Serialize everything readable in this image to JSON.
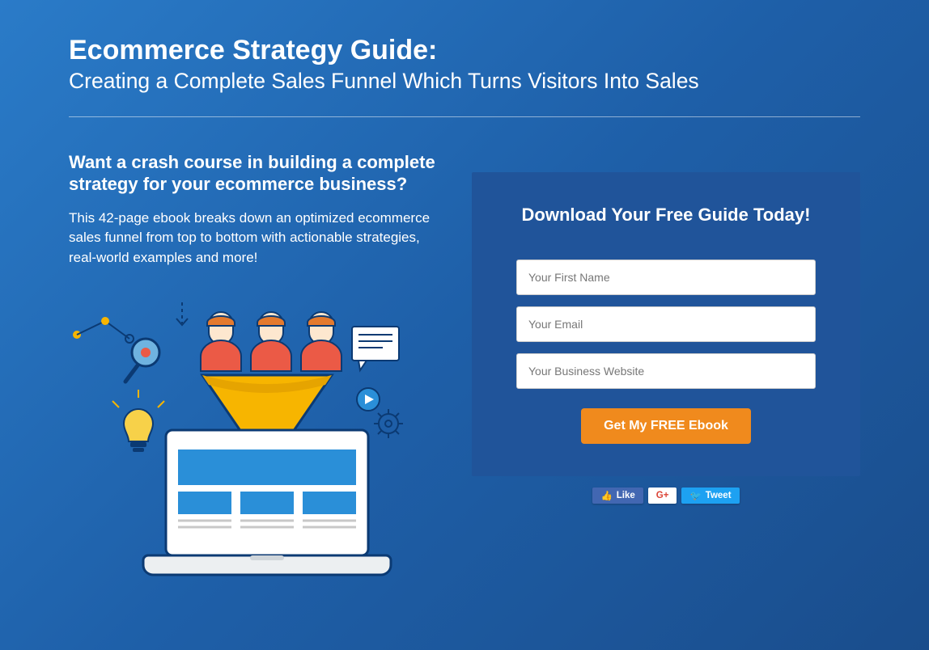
{
  "header": {
    "title": "Ecommerce Strategy Guide:",
    "subtitle": "Creating a Complete Sales Funnel Which Turns Visitors Into Sales"
  },
  "left": {
    "question": "Want a crash course in building a complete strategy for your ecommerce business?",
    "body": "This 42-page ebook breaks down an optimized ecommerce sales funnel from top to bottom with actionable strategies, real-world examples and more!"
  },
  "form": {
    "heading": "Download Your Free Guide Today!",
    "first_name_placeholder": "Your First Name",
    "email_placeholder": "Your Email",
    "website_placeholder": "Your Business Website",
    "submit_label": "Get My FREE Ebook"
  },
  "social": {
    "like": "Like",
    "gplus": "G+",
    "tweet": "Tweet"
  },
  "colors": {
    "accent": "#f08a1d",
    "card_bg": "#20549a"
  }
}
